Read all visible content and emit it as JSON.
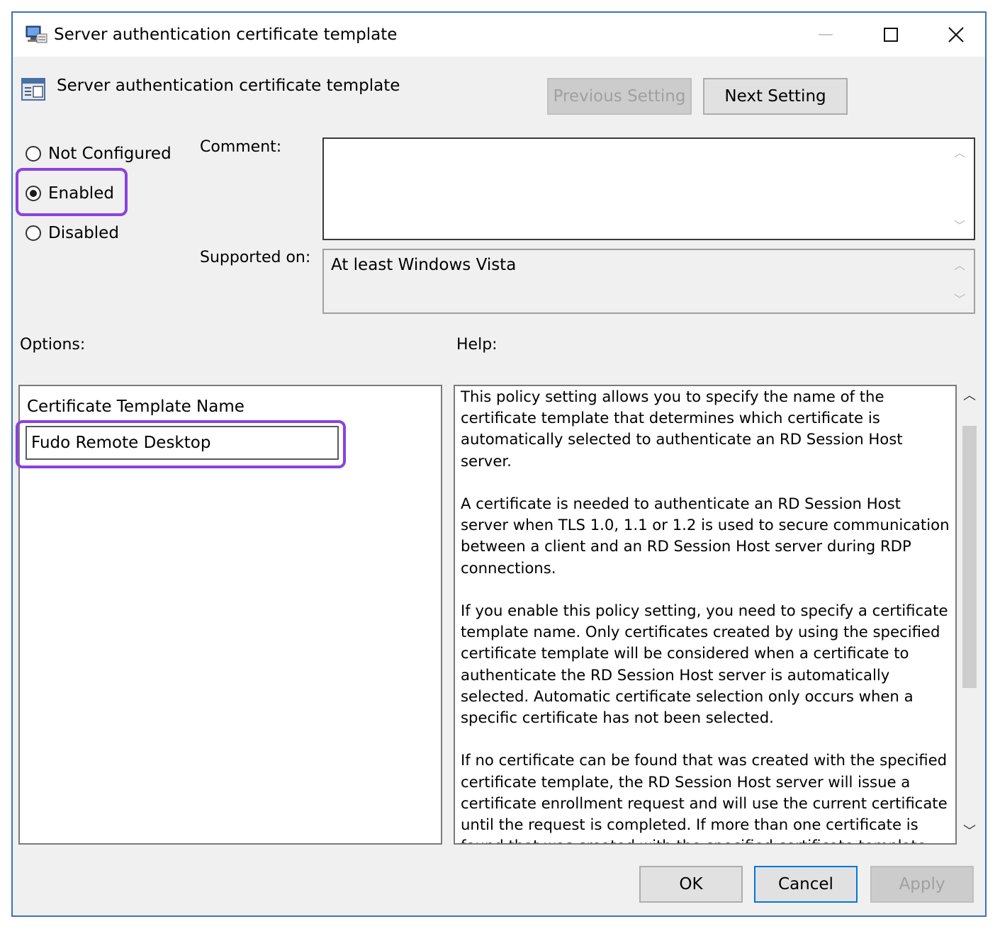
{
  "window": {
    "title": "Server authentication certificate template",
    "controls": {
      "minimize": "—",
      "close": "✕"
    }
  },
  "header": {
    "title": "Server authentication certificate template",
    "previous_setting": "Previous Setting",
    "next_setting": "Next Setting"
  },
  "state": {
    "options": [
      {
        "label": "Not Configured",
        "selected": false
      },
      {
        "label": "Enabled",
        "selected": true
      },
      {
        "label": "Disabled",
        "selected": false
      }
    ]
  },
  "comment": {
    "label": "Comment:",
    "value": ""
  },
  "supported_on": {
    "label": "Supported on:",
    "value": "At least Windows Vista"
  },
  "options_section": {
    "label": "Options:",
    "field_label": "Certificate Template Name",
    "field_value": "Fudo Remote Desktop"
  },
  "help_section": {
    "label": "Help:",
    "paragraphs": [
      "This policy setting allows you to specify the name of the certificate template that determines which certificate is automatically selected to authenticate an RD Session Host server.",
      "A certificate is needed to authenticate an RD Session Host server when TLS 1.0, 1.1 or 1.2 is used to secure communication between a client and an RD Session Host server during RDP connections.",
      "If you enable this policy setting, you need to specify a certificate template name. Only certificates created by using the specified certificate template will be considered when a certificate to authenticate the RD Session Host server is automatically selected. Automatic certificate selection only occurs when a specific certificate has not been selected.",
      "If no certificate can be found that was created with the specified certificate template, the RD Session Host server will issue a certificate enrollment request and will use the current certificate until the request is completed. If more than one certificate is found that was created with the specified certificate template,"
    ]
  },
  "footer": {
    "ok": "OK",
    "cancel": "Cancel",
    "apply": "Apply"
  },
  "icons": {
    "title": "policy-computer-icon",
    "header": "policy-setting-icon",
    "scroll_up": "chevron-up-icon",
    "scroll_down": "chevron-down-icon"
  },
  "colors": {
    "highlight": "#8a42e0",
    "window_border": "#3c73b8",
    "default_button_border": "#0078d7",
    "dialog_bg": "#f0f0f0"
  }
}
